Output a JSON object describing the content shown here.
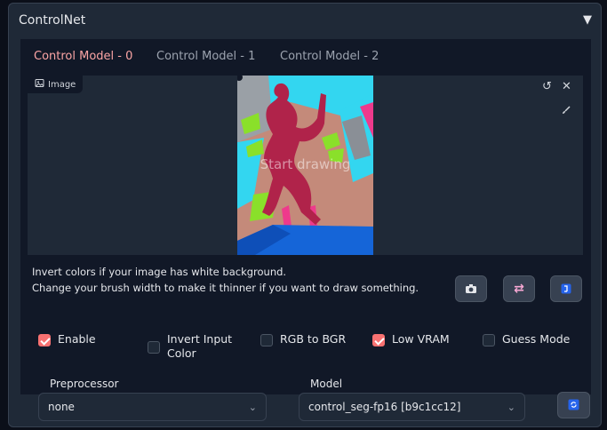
{
  "header": {
    "title": "ControlNet",
    "toggle_icon": "triangle-down-icon"
  },
  "tabs": [
    {
      "label": "Control Model - 0",
      "active": true
    },
    {
      "label": "Control Model - 1",
      "active": false
    },
    {
      "label": "Control Model - 2",
      "active": false
    }
  ],
  "canvas": {
    "badge_label": "Image",
    "overlay_text": "Start drawing",
    "icons": [
      "image-icon",
      "undo-icon",
      "close-icon",
      "brush-icon"
    ]
  },
  "hints": {
    "line1": "Invert colors if your image has white background.",
    "line2": "Change your brush width to make it thinner if you want to draw something."
  },
  "tool_buttons": [
    "camera-icon",
    "swap-icon",
    "send-dimensions-icon"
  ],
  "checkboxes": [
    {
      "label": "Enable",
      "checked": true
    },
    {
      "label": "Invert Input Color",
      "checked": false
    },
    {
      "label": "RGB to BGR",
      "checked": false
    },
    {
      "label": "Low VRAM",
      "checked": true
    },
    {
      "label": "Guess Mode",
      "checked": false
    }
  ],
  "preprocessor": {
    "label": "Preprocessor",
    "value": "none"
  },
  "model": {
    "label": "Model",
    "value": "control_seg-fp16 [b9c1cc12]"
  },
  "colors": {
    "accent": "#f87171",
    "panel_bg": "#1f2937",
    "page_bg": "#0b0f19"
  }
}
